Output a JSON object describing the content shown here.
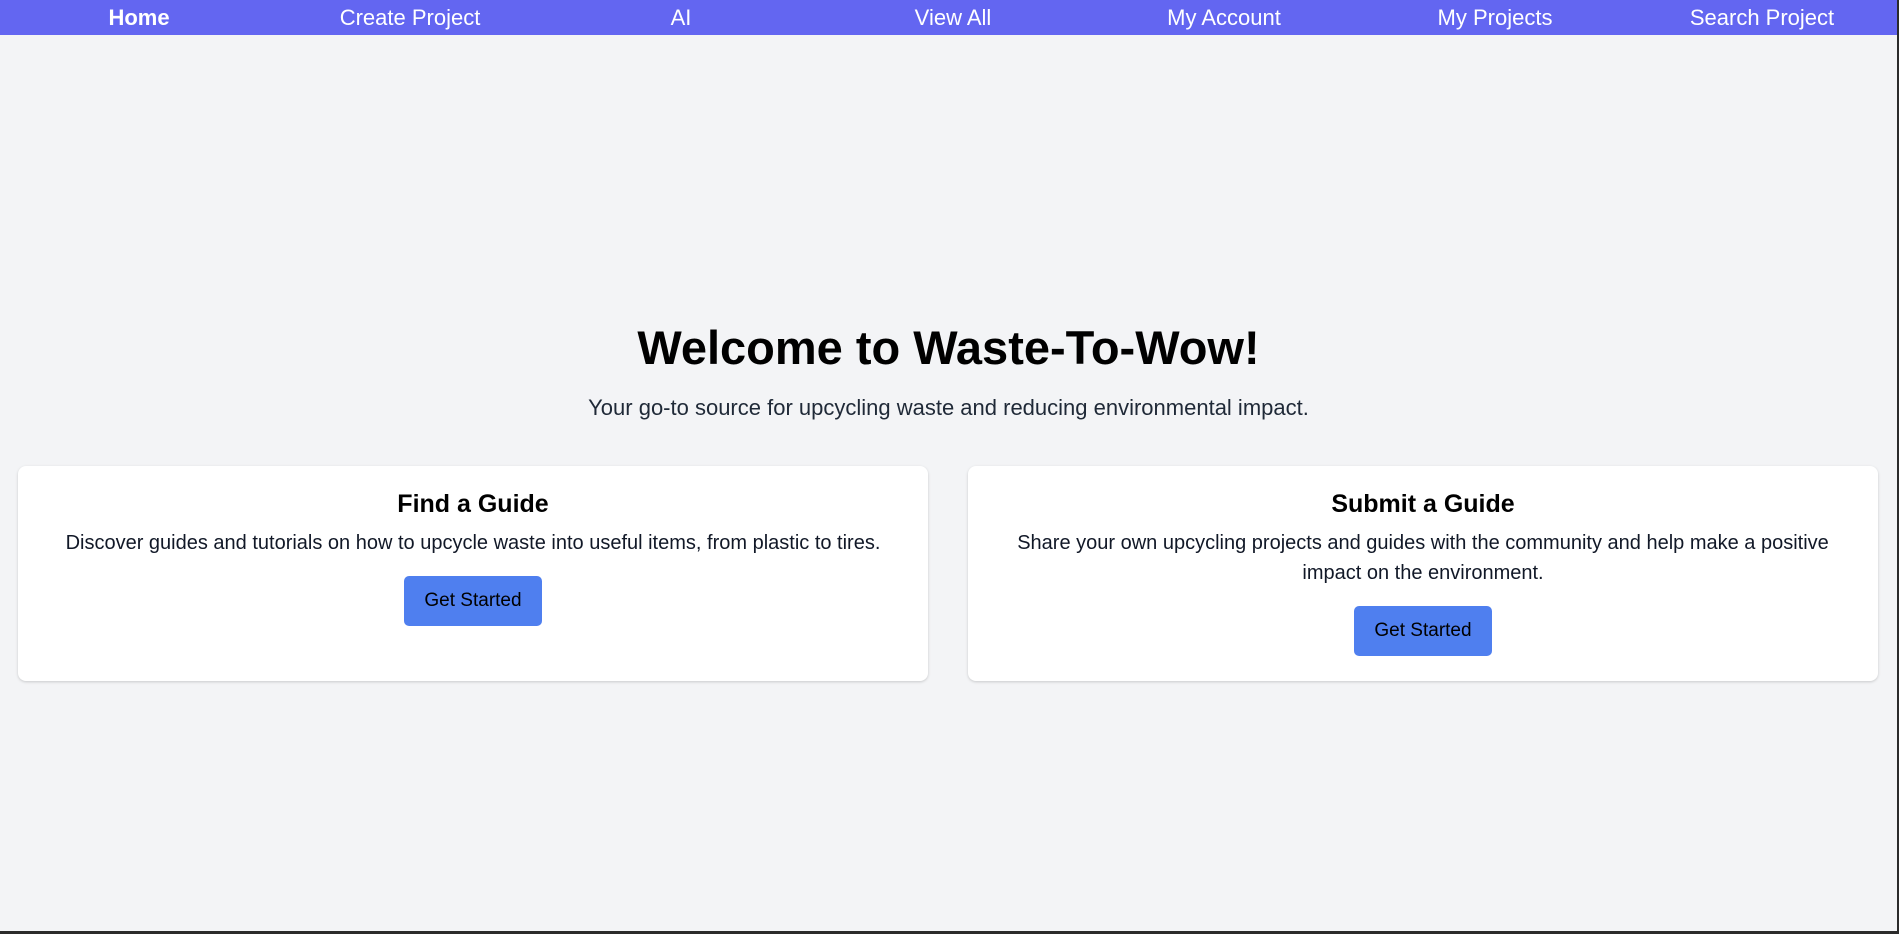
{
  "nav": {
    "items": [
      {
        "label": "Home",
        "active": true
      },
      {
        "label": "Create Project",
        "active": false
      },
      {
        "label": "AI",
        "active": false
      },
      {
        "label": "View All",
        "active": false
      },
      {
        "label": "My Account",
        "active": false
      },
      {
        "label": "My Projects",
        "active": false
      },
      {
        "label": "Search Project",
        "active": false
      }
    ]
  },
  "hero": {
    "title": "Welcome to Waste-To-Wow!",
    "subtitle": "Your go-to source for upcycling waste and reducing environmental impact."
  },
  "cards": [
    {
      "title": "Find a Guide",
      "text": "Discover guides and tutorials on how to upcycle waste into useful items, from plastic to tires.",
      "button_label": "Get Started"
    },
    {
      "title": "Submit a Guide",
      "text": "Share your own upcycling projects and guides with the community and help make a positive impact on the environment.",
      "button_label": "Get Started"
    }
  ],
  "colors": {
    "navbar": "#6366f1",
    "background": "#f3f4f6",
    "card": "#ffffff",
    "button": "#4f7fef"
  }
}
